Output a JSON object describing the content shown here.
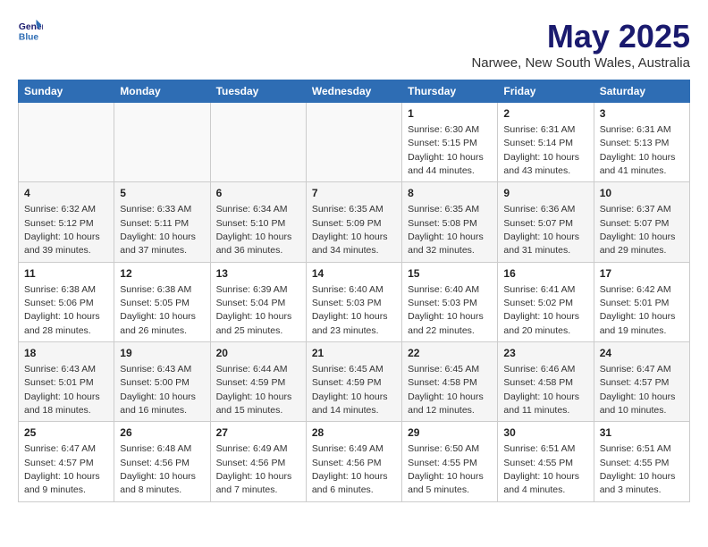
{
  "header": {
    "logo_line1": "General",
    "logo_line2": "Blue",
    "title": "May 2025",
    "subtitle": "Narwee, New South Wales, Australia"
  },
  "days_of_week": [
    "Sunday",
    "Monday",
    "Tuesday",
    "Wednesday",
    "Thursday",
    "Friday",
    "Saturday"
  ],
  "weeks": [
    [
      {
        "day": "",
        "info": ""
      },
      {
        "day": "",
        "info": ""
      },
      {
        "day": "",
        "info": ""
      },
      {
        "day": "",
        "info": ""
      },
      {
        "day": "1",
        "info": "Sunrise: 6:30 AM\nSunset: 5:15 PM\nDaylight: 10 hours\nand 44 minutes."
      },
      {
        "day": "2",
        "info": "Sunrise: 6:31 AM\nSunset: 5:14 PM\nDaylight: 10 hours\nand 43 minutes."
      },
      {
        "day": "3",
        "info": "Sunrise: 6:31 AM\nSunset: 5:13 PM\nDaylight: 10 hours\nand 41 minutes."
      }
    ],
    [
      {
        "day": "4",
        "info": "Sunrise: 6:32 AM\nSunset: 5:12 PM\nDaylight: 10 hours\nand 39 minutes."
      },
      {
        "day": "5",
        "info": "Sunrise: 6:33 AM\nSunset: 5:11 PM\nDaylight: 10 hours\nand 37 minutes."
      },
      {
        "day": "6",
        "info": "Sunrise: 6:34 AM\nSunset: 5:10 PM\nDaylight: 10 hours\nand 36 minutes."
      },
      {
        "day": "7",
        "info": "Sunrise: 6:35 AM\nSunset: 5:09 PM\nDaylight: 10 hours\nand 34 minutes."
      },
      {
        "day": "8",
        "info": "Sunrise: 6:35 AM\nSunset: 5:08 PM\nDaylight: 10 hours\nand 32 minutes."
      },
      {
        "day": "9",
        "info": "Sunrise: 6:36 AM\nSunset: 5:07 PM\nDaylight: 10 hours\nand 31 minutes."
      },
      {
        "day": "10",
        "info": "Sunrise: 6:37 AM\nSunset: 5:07 PM\nDaylight: 10 hours\nand 29 minutes."
      }
    ],
    [
      {
        "day": "11",
        "info": "Sunrise: 6:38 AM\nSunset: 5:06 PM\nDaylight: 10 hours\nand 28 minutes."
      },
      {
        "day": "12",
        "info": "Sunrise: 6:38 AM\nSunset: 5:05 PM\nDaylight: 10 hours\nand 26 minutes."
      },
      {
        "day": "13",
        "info": "Sunrise: 6:39 AM\nSunset: 5:04 PM\nDaylight: 10 hours\nand 25 minutes."
      },
      {
        "day": "14",
        "info": "Sunrise: 6:40 AM\nSunset: 5:03 PM\nDaylight: 10 hours\nand 23 minutes."
      },
      {
        "day": "15",
        "info": "Sunrise: 6:40 AM\nSunset: 5:03 PM\nDaylight: 10 hours\nand 22 minutes."
      },
      {
        "day": "16",
        "info": "Sunrise: 6:41 AM\nSunset: 5:02 PM\nDaylight: 10 hours\nand 20 minutes."
      },
      {
        "day": "17",
        "info": "Sunrise: 6:42 AM\nSunset: 5:01 PM\nDaylight: 10 hours\nand 19 minutes."
      }
    ],
    [
      {
        "day": "18",
        "info": "Sunrise: 6:43 AM\nSunset: 5:01 PM\nDaylight: 10 hours\nand 18 minutes."
      },
      {
        "day": "19",
        "info": "Sunrise: 6:43 AM\nSunset: 5:00 PM\nDaylight: 10 hours\nand 16 minutes."
      },
      {
        "day": "20",
        "info": "Sunrise: 6:44 AM\nSunset: 4:59 PM\nDaylight: 10 hours\nand 15 minutes."
      },
      {
        "day": "21",
        "info": "Sunrise: 6:45 AM\nSunset: 4:59 PM\nDaylight: 10 hours\nand 14 minutes."
      },
      {
        "day": "22",
        "info": "Sunrise: 6:45 AM\nSunset: 4:58 PM\nDaylight: 10 hours\nand 12 minutes."
      },
      {
        "day": "23",
        "info": "Sunrise: 6:46 AM\nSunset: 4:58 PM\nDaylight: 10 hours\nand 11 minutes."
      },
      {
        "day": "24",
        "info": "Sunrise: 6:47 AM\nSunset: 4:57 PM\nDaylight: 10 hours\nand 10 minutes."
      }
    ],
    [
      {
        "day": "25",
        "info": "Sunrise: 6:47 AM\nSunset: 4:57 PM\nDaylight: 10 hours\nand 9 minutes."
      },
      {
        "day": "26",
        "info": "Sunrise: 6:48 AM\nSunset: 4:56 PM\nDaylight: 10 hours\nand 8 minutes."
      },
      {
        "day": "27",
        "info": "Sunrise: 6:49 AM\nSunset: 4:56 PM\nDaylight: 10 hours\nand 7 minutes."
      },
      {
        "day": "28",
        "info": "Sunrise: 6:49 AM\nSunset: 4:56 PM\nDaylight: 10 hours\nand 6 minutes."
      },
      {
        "day": "29",
        "info": "Sunrise: 6:50 AM\nSunset: 4:55 PM\nDaylight: 10 hours\nand 5 minutes."
      },
      {
        "day": "30",
        "info": "Sunrise: 6:51 AM\nSunset: 4:55 PM\nDaylight: 10 hours\nand 4 minutes."
      },
      {
        "day": "31",
        "info": "Sunrise: 6:51 AM\nSunset: 4:55 PM\nDaylight: 10 hours\nand 3 minutes."
      }
    ]
  ]
}
